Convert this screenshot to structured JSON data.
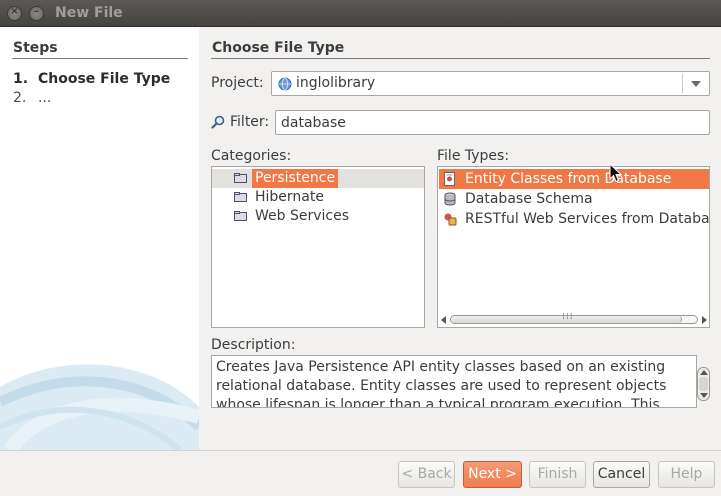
{
  "window": {
    "title": "New File"
  },
  "steps": {
    "heading": "Steps",
    "items": [
      {
        "number": "1.",
        "label": "Choose File Type"
      },
      {
        "number": "2.",
        "label": "..."
      }
    ]
  },
  "main": {
    "heading": "Choose File Type",
    "project": {
      "label": "Project:",
      "value": "inglolibrary"
    },
    "filter": {
      "label": "Filter:",
      "value": "database"
    },
    "categories": {
      "label": "Categories:",
      "items": [
        {
          "label": "Persistence",
          "selected": true
        },
        {
          "label": "Hibernate",
          "selected": false
        },
        {
          "label": "Web Services",
          "selected": false
        }
      ]
    },
    "file_types": {
      "label": "File Types:",
      "items": [
        {
          "label": "Entity Classes from Database",
          "icon": "entity-icon",
          "selected": true
        },
        {
          "label": "Database Schema",
          "icon": "database-icon",
          "selected": false
        },
        {
          "label": "RESTful Web Services from Database",
          "icon": "restful-icon",
          "selected": false
        }
      ]
    },
    "description": {
      "label": "Description:",
      "text": "Creates Java Persistence API entity classes based on an existing relational database. Entity classes are used to represent objects whose lifespan is longer than a typical program execution. This"
    }
  },
  "buttons": {
    "back": "< Back",
    "next": "Next >",
    "finish": "Finish",
    "cancel": "Cancel",
    "help": "Help"
  },
  "colors": {
    "selection": "#f07746",
    "titlebar": "#4f4e4a"
  }
}
